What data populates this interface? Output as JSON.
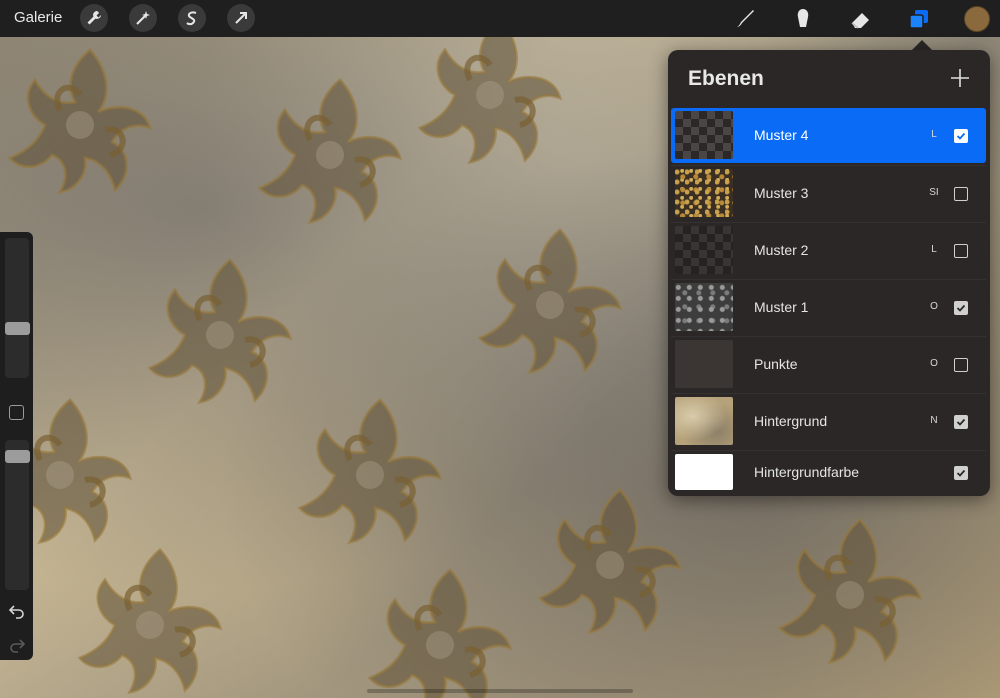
{
  "toolbar": {
    "gallery_label": "Galerie",
    "left_tools": [
      "wrench-icon",
      "magic-wand-icon",
      "selection-icon",
      "transform-arrow-icon"
    ],
    "right_tools": [
      "brush-icon",
      "smudge-icon",
      "eraser-icon",
      "layers-icon"
    ],
    "current_color": "#8a6a3d",
    "accent_color": "#0a6cf6"
  },
  "sidebar": {
    "undo_icon": "undo-icon",
    "redo_icon": "redo-icon"
  },
  "layers_panel": {
    "title": "Ebenen",
    "add_icon": "plus-icon",
    "layers": [
      {
        "name": "Muster 4",
        "blend": "L",
        "visible": true,
        "active": true
      },
      {
        "name": "Muster 3",
        "blend": "SI",
        "visible": false,
        "active": false
      },
      {
        "name": "Muster 2",
        "blend": "L",
        "visible": false,
        "active": false
      },
      {
        "name": "Muster 1",
        "blend": "O",
        "visible": true,
        "active": false
      },
      {
        "name": "Punkte",
        "blend": "O",
        "visible": false,
        "active": false
      },
      {
        "name": "Hintergrund",
        "blend": "N",
        "visible": true,
        "active": false
      },
      {
        "name": "Hintergrundfarbe",
        "blend": "",
        "visible": true,
        "active": false
      }
    ]
  }
}
